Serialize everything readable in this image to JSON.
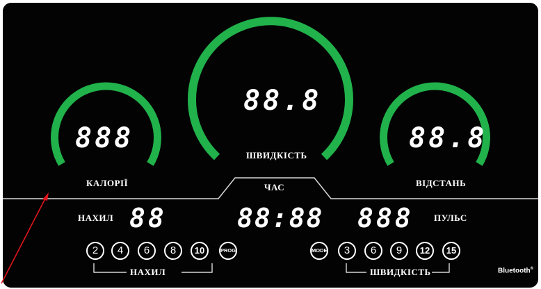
{
  "gauges": {
    "calories": {
      "display": "888",
      "label": "КАЛОРІЇ"
    },
    "speed": {
      "display": "88.8",
      "label": "ШВИДКІСТЬ"
    },
    "distance": {
      "display": "88.8",
      "label": "ВІДСТАНЬ"
    }
  },
  "time": {
    "label": "ЧАС",
    "display": "88:88"
  },
  "incline": {
    "label": "НАХИЛ",
    "display": "88"
  },
  "pulse": {
    "label": "ПУЛЬС",
    "display": "888"
  },
  "incline_buttons": {
    "values": [
      "2",
      "4",
      "6",
      "8",
      "10"
    ],
    "prog": "PROG",
    "group_label": "НАХИЛ"
  },
  "speed_buttons": {
    "mode": "MODE",
    "values": [
      "3",
      "6",
      "9",
      "12",
      "15"
    ],
    "group_label": "ШВИДКІСТЬ"
  },
  "brand": "Bluetooth",
  "brand_mark": "®",
  "colors": {
    "arc": "#21b24b",
    "panel": "#030303",
    "text": "#ffffff",
    "annotation": "#e0141c"
  }
}
